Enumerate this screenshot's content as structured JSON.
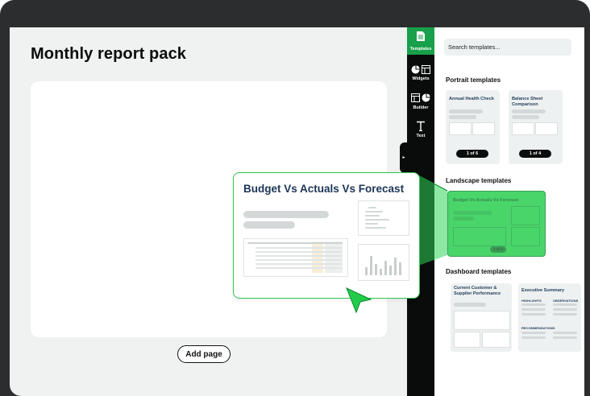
{
  "main": {
    "title": "Monthly report pack",
    "add_page_label": "Add page"
  },
  "rail": {
    "items": [
      {
        "label": "Templates"
      },
      {
        "label": "Widgets"
      },
      {
        "label": "Builder"
      },
      {
        "label": "Text"
      }
    ]
  },
  "panel": {
    "search": {
      "placeholder": "Search templates..."
    },
    "sections": {
      "portrait": "Portrait templates",
      "landscape": "Landscape templates",
      "dashboard": "Dashboard templates"
    },
    "portrait_cards": [
      {
        "title": "Annual Health Check",
        "badge": "1 of 6"
      },
      {
        "title": "Balance Sheet Comparison",
        "badge": "1 of 4"
      }
    ],
    "landscape_cards": [
      {
        "title": "Budget Vs Actuals Vs Forecast",
        "badge": "1 of 3"
      }
    ],
    "dashboard_cards": [
      {
        "title": "Current Customer & Supplier Performance"
      },
      {
        "title": "Executive Summary",
        "labels": [
          "HIGHLIGHTS",
          "OBSERVATIONS",
          "RECOMMENDATIONS"
        ]
      }
    ]
  },
  "preview": {
    "title": "Budget Vs Actuals Vs Forecast"
  },
  "colors": {
    "accent": "#19a04a",
    "highlight": "#22cc4a",
    "dark": "#0a0b0b"
  }
}
